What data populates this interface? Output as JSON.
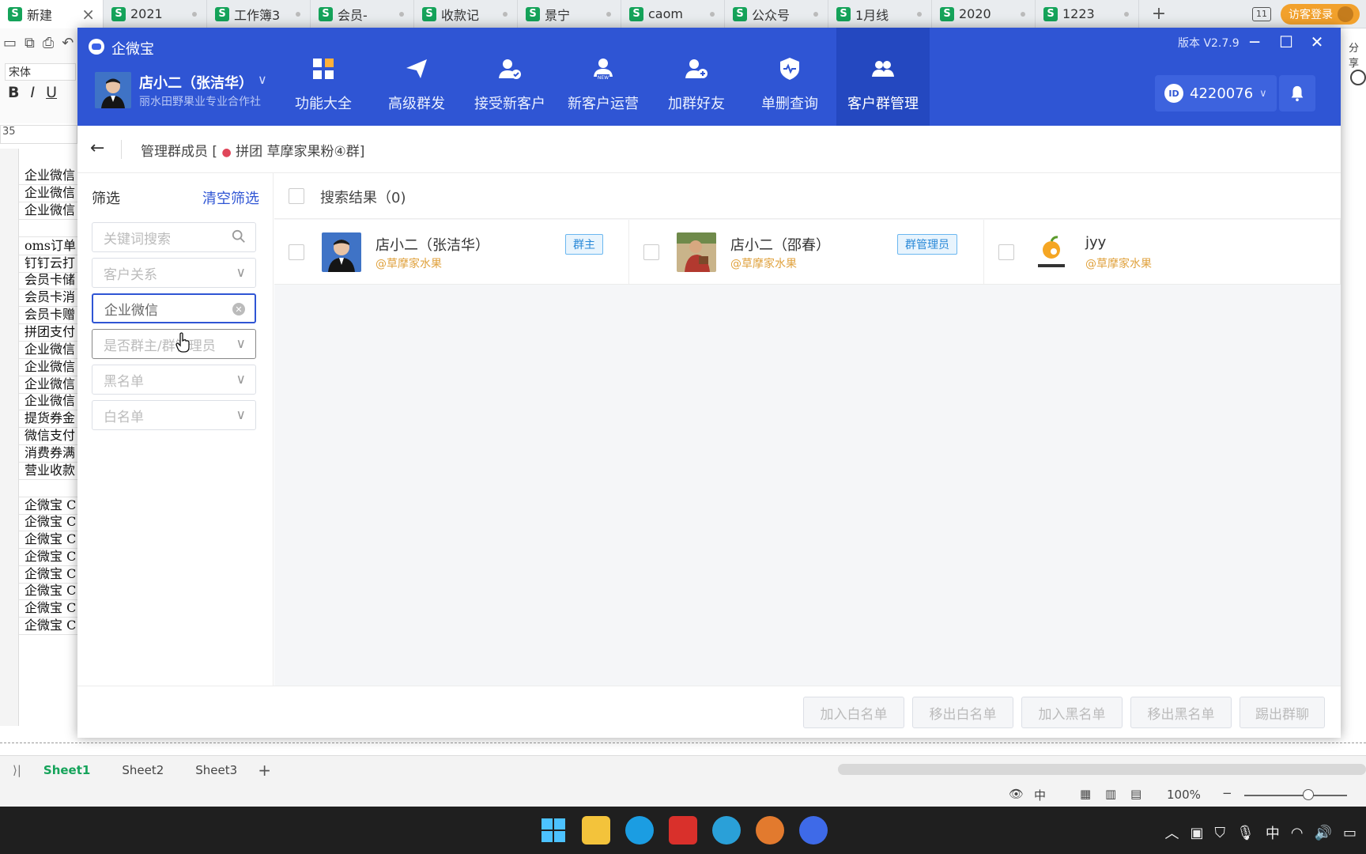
{
  "browser_tabs": [
    {
      "label": "新建 ",
      "active": true
    },
    {
      "label": "2021"
    },
    {
      "label": "工作簿3"
    },
    {
      "label": "会员-"
    },
    {
      "label": "收款记"
    },
    {
      "label": "景宁"
    },
    {
      "label": "caom"
    },
    {
      "label": "公众号"
    },
    {
      "label": "1月线"
    },
    {
      "label": "2020"
    },
    {
      "label": "1223"
    }
  ],
  "top_right": {
    "guest_login": "访客登录",
    "page_count": "11"
  },
  "spreadsheet": {
    "font_name": "宋体",
    "namebox": "35",
    "rows": [
      "企业微信",
      "企业微信",
      "企业微信",
      "",
      "oms订单",
      "钉钉云打",
      "会员卡储",
      "会员卡消",
      "会员卡赠",
      "拼团支付",
      "企业微信",
      "企业微信",
      "企业微信",
      "企业微信",
      "提货券金",
      "微信支付",
      "消费券满",
      "营业收款",
      "",
      "企微宝 C",
      "企微宝 C",
      "企微宝 C",
      "企微宝 C",
      "企微宝 C",
      "企微宝 C",
      "企微宝 C",
      "企微宝 C"
    ],
    "sheets": [
      "Sheet1",
      "Sheet2",
      "Sheet3"
    ],
    "active_sheet": "Sheet1",
    "zoom": "100%",
    "ime": "中",
    "right_tool": "分享"
  },
  "app": {
    "title": "企微宝",
    "version": "版本 V2.7.9",
    "user": {
      "name": "店小二（张洁华）",
      "org": "丽水田野果业专业合作社"
    },
    "nav": [
      {
        "label": "功能大全",
        "icon": "grid-icon"
      },
      {
        "label": "高级群发",
        "icon": "paper-plane-icon"
      },
      {
        "label": "接受新客户",
        "icon": "user-check-icon"
      },
      {
        "label": "新客户运营",
        "icon": "user-new-icon"
      },
      {
        "label": "加群好友",
        "icon": "user-plus-icon"
      },
      {
        "label": "单删查询",
        "icon": "shield-pulse-icon"
      },
      {
        "label": "客户群管理",
        "icon": "users-icon",
        "active": true
      }
    ],
    "id_label": "ID",
    "id_value": "4220076",
    "breadcrumb": "管理群成员 [",
    "group_name": "拼团 草摩家果粉④群]",
    "filter": {
      "title": "筛选",
      "clear": "清空筛选",
      "keyword_placeholder": "关键词搜索",
      "relation_placeholder": "客户关系",
      "source_value": "企业微信",
      "role_placeholder": "是否群主/群管理员",
      "blacklist_placeholder": "黑名单",
      "whitelist_placeholder": "白名单"
    },
    "results_title": "搜索结果（0)",
    "members": [
      {
        "name": "店小二（张洁华）",
        "org": "@草摩家水果",
        "badge": "群主"
      },
      {
        "name": "店小二（邵春）",
        "org": "@草摩家水果",
        "badge": "群管理员"
      },
      {
        "name": "jyy",
        "org": "@草摩家水果",
        "badge": ""
      }
    ],
    "actions": [
      "加入白名单",
      "移出白名单",
      "加入黑名单",
      "移出黑名单",
      "踢出群聊"
    ],
    "colors": {
      "header": "#2f55d4",
      "accent": "#2f55d4",
      "org_text": "#e0a23e",
      "badge": "#2a89d8"
    }
  }
}
